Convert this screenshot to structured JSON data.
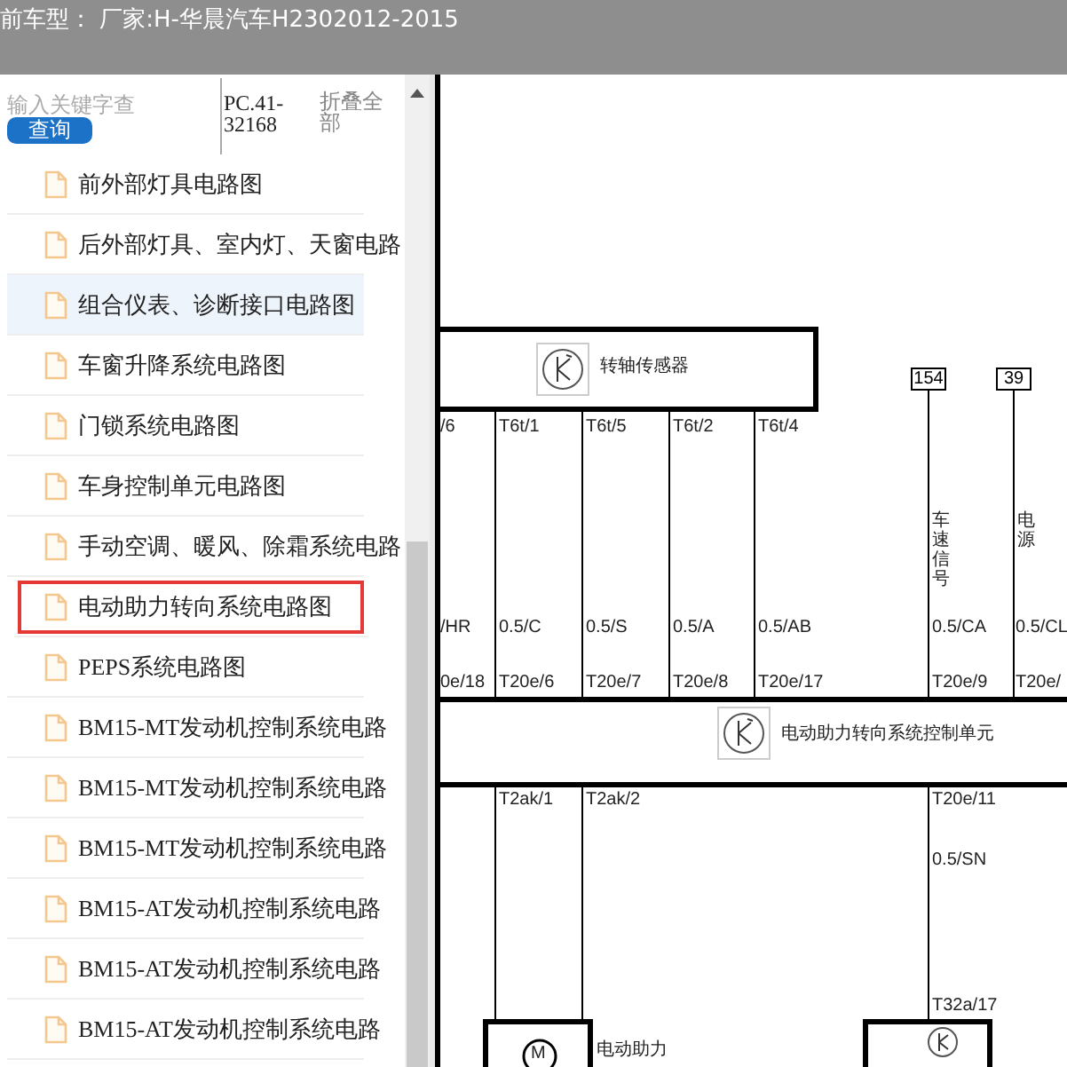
{
  "header": {
    "title": "前车型： 厂家:H-华晨汽车H2302012-2015"
  },
  "search": {
    "placeholder": "输入关键字查",
    "button": "查询"
  },
  "code": "PC.41-32168",
  "collapse": "折叠全部",
  "items": [
    {
      "label": "前外部灯具电路图",
      "hovered": false,
      "selected": false
    },
    {
      "label": "后外部灯具、室内灯、天窗电路",
      "hovered": false,
      "selected": false
    },
    {
      "label": "组合仪表、诊断接口电路图",
      "hovered": true,
      "selected": false
    },
    {
      "label": "车窗升降系统电路图",
      "hovered": false,
      "selected": false
    },
    {
      "label": "门锁系统电路图",
      "hovered": false,
      "selected": false
    },
    {
      "label": "车身控制单元电路图",
      "hovered": false,
      "selected": false
    },
    {
      "label": "手动空调、暖风、除霜系统电路",
      "hovered": false,
      "selected": false
    },
    {
      "label": "电动助力转向系统电路图",
      "hovered": false,
      "selected": true
    },
    {
      "label": "PEPS系统电路图",
      "hovered": false,
      "selected": false
    },
    {
      "label": "BM15-MT发动机控制系统电路",
      "hovered": false,
      "selected": false
    },
    {
      "label": "BM15-MT发动机控制系统电路",
      "hovered": false,
      "selected": false
    },
    {
      "label": "BM15-MT发动机控制系统电路",
      "hovered": false,
      "selected": false
    },
    {
      "label": "BM15-AT发动机控制系统电路",
      "hovered": false,
      "selected": false
    },
    {
      "label": "BM15-AT发动机控制系统电路",
      "hovered": false,
      "selected": false
    },
    {
      "label": "BM15-AT发动机控制系统电路",
      "hovered": false,
      "selected": false
    }
  ],
  "diagram": {
    "sensor": {
      "label": "转轴传感器"
    },
    "wires": [
      {
        "top": "/6",
        "gauge": "/HR",
        "bottom": "0e/18"
      },
      {
        "top": "T6t/1",
        "gauge": "0.5/C",
        "bottom": "T20e/6"
      },
      {
        "top": "T6t/5",
        "gauge": "0.5/S",
        "bottom": "T20e/7"
      },
      {
        "top": "T6t/2",
        "gauge": "0.5/A",
        "bottom": "T20e/8"
      },
      {
        "top": "T6t/4",
        "gauge": "0.5/AB",
        "bottom": "T20e/17"
      },
      {
        "connector": "154",
        "signal": "车速信号",
        "gauge": "0.5/CA",
        "bottom": "T20e/9"
      },
      {
        "connector": "39",
        "signal": "电源",
        "gauge": "0.5/CL",
        "bottom": "T20e/"
      }
    ],
    "unit": {
      "label": "电动助力转向系统控制单元"
    },
    "lower_wires": [
      {
        "top": "T2ak/1"
      },
      {
        "top": "T2ak/2"
      },
      {
        "top": "T20e/11",
        "gauge": "0.5/SN",
        "bottom": "T32a/17"
      }
    ],
    "motor": {
      "symbol": "M",
      "label": "电动助力"
    }
  }
}
